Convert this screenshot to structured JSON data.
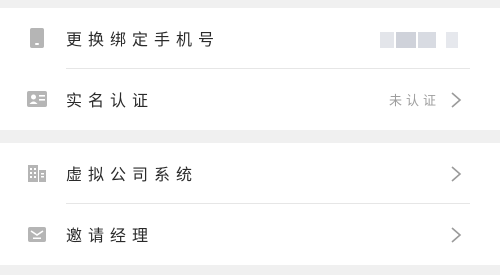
{
  "colors": {
    "page_bg": "#f0f0f0",
    "card_bg": "#ffffff",
    "icon": "#b5b5b5",
    "divider": "#e6e6e6",
    "muted_text": "#9e9e9e"
  },
  "groups": [
    {
      "items": [
        {
          "icon": "phone-icon",
          "label": "更换绑定手机号",
          "value_masked": true
        },
        {
          "icon": "id-card-icon",
          "label": "实名认证",
          "status": "未认证",
          "chevron": true
        }
      ]
    },
    {
      "items": [
        {
          "icon": "company-icon",
          "label": "虚拟公司系统",
          "chevron": true
        },
        {
          "icon": "invite-mail-icon",
          "label": "邀请经理",
          "chevron": true
        }
      ]
    }
  ]
}
